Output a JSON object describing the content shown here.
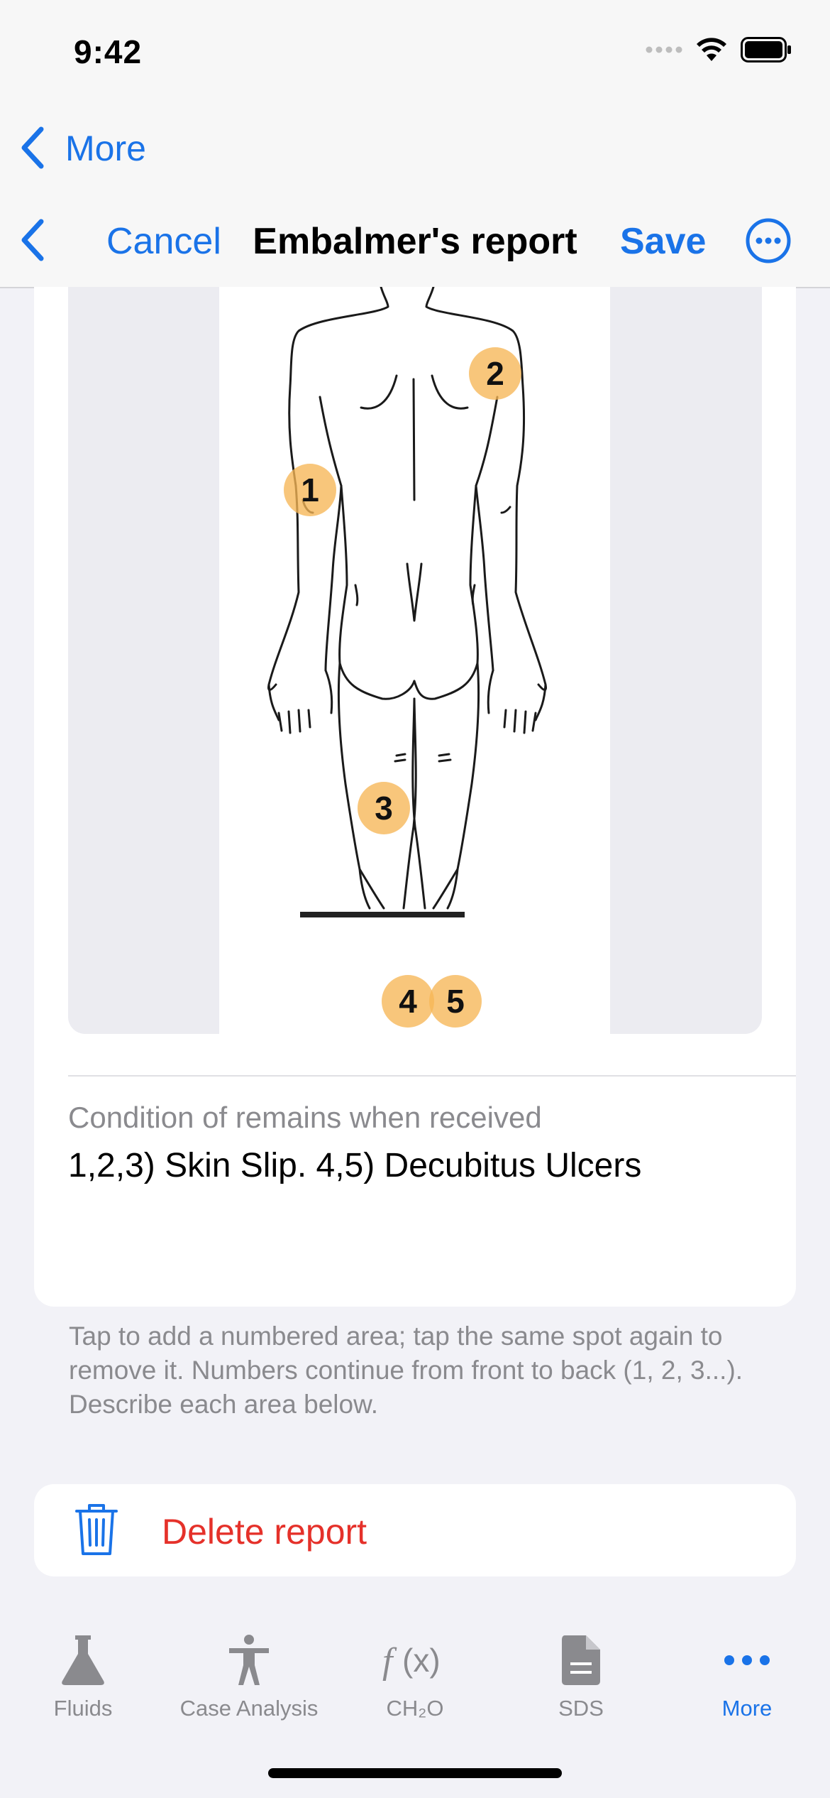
{
  "status": {
    "time": "9:42"
  },
  "nav": {
    "back_label": "More",
    "cancel_label": "Cancel",
    "title": "Embalmer's report",
    "save_label": "Save"
  },
  "diagram": {
    "markers": [
      "1",
      "2",
      "3",
      "4",
      "5"
    ]
  },
  "condition": {
    "label": "Condition of remains when received",
    "value": "1,2,3) Skin Slip. 4,5) Decubitus Ulcers"
  },
  "footnote": "Tap to add a numbered area; tap the same spot again to remove it. Numbers continue from front to back (1, 2, 3...). Describe each area below.",
  "delete_label": "Delete report",
  "tabs": [
    {
      "label": "Fluids",
      "icon": "flask-icon"
    },
    {
      "label": "Case Analysis",
      "icon": "person-icon"
    },
    {
      "label": "CH₂O",
      "icon": "function-icon"
    },
    {
      "label": "SDS",
      "icon": "document-icon"
    },
    {
      "label": "More",
      "icon": "ellipsis-icon"
    }
  ],
  "colors": {
    "accent": "#1a73e8",
    "destructive": "#e5312a",
    "marker": "#f6b656"
  }
}
